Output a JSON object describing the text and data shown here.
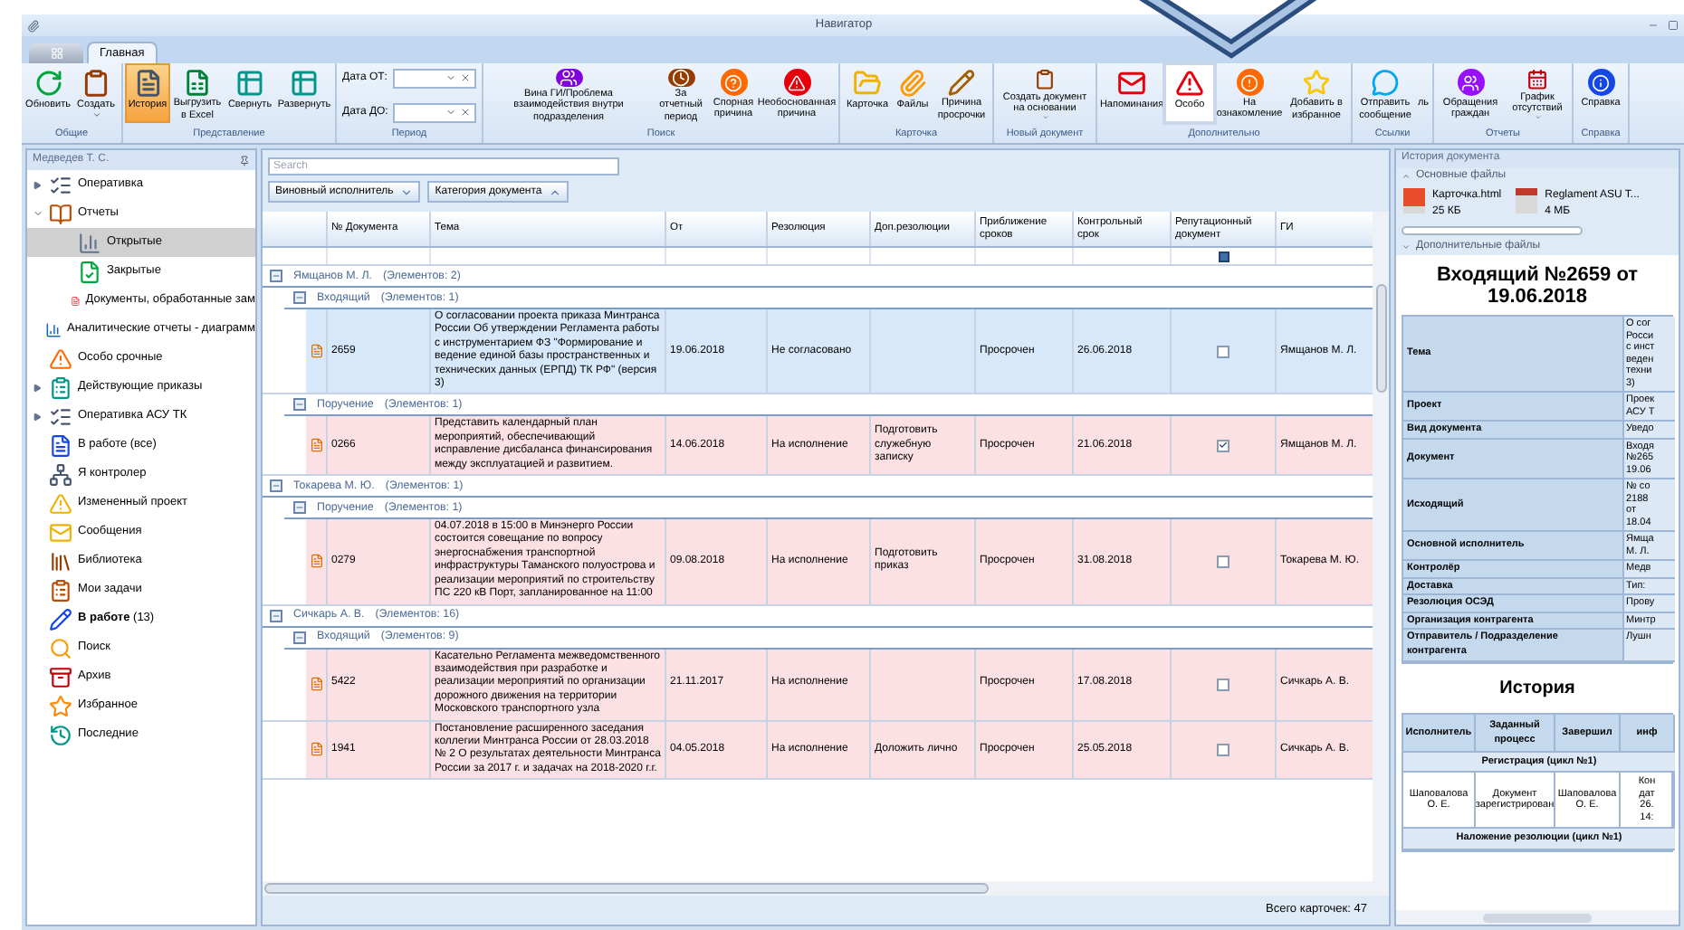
{
  "window": {
    "title": "Навигатор"
  },
  "ribbon_tabs": [
    {
      "label": "Главная",
      "selected": true
    }
  ],
  "ribbon_groups": [
    {
      "label": "Общие",
      "items": [
        {
          "kind": "button",
          "label": "Обновить",
          "selected": false,
          "hovered": false,
          "dropdown": false
        },
        {
          "kind": "button",
          "label": "Создать",
          "selected": false,
          "hovered": false,
          "dropdown": true
        }
      ]
    },
    {
      "label": "Представление",
      "items": [
        {
          "kind": "button",
          "label": "История",
          "selected": true,
          "hovered": false,
          "dropdown": false
        },
        {
          "kind": "button",
          "label": "Выгрузить в Excel",
          "selected": false,
          "hovered": false,
          "dropdown": false
        },
        {
          "kind": "button",
          "label": "Свернуть",
          "selected": false,
          "hovered": false,
          "dropdown": false
        },
        {
          "kind": "button",
          "label": "Развернуть",
          "selected": false,
          "hovered": false,
          "dropdown": false
        }
      ]
    },
    {
      "label": "Период",
      "items": [
        {
          "kind": "field",
          "label": "Дата ОТ:"
        },
        {
          "kind": "field",
          "label": "Дата ДО:"
        }
      ]
    },
    {
      "label": "Поиск",
      "items": [
        {
          "kind": "button",
          "label": "Вина ГИ/Проблема взаимодействия внутри подразделения",
          "selected": false,
          "hovered": false,
          "dropdown": false
        },
        {
          "kind": "button",
          "label": "За отчетный период",
          "selected": false,
          "hovered": false,
          "dropdown": false
        },
        {
          "kind": "button",
          "label": "Спорная причина",
          "selected": false,
          "hovered": false,
          "dropdown": false
        },
        {
          "kind": "button",
          "label": "Необоснованная причина",
          "selected": false,
          "hovered": false,
          "dropdown": false
        }
      ]
    },
    {
      "label": "Карточка",
      "items": [
        {
          "kind": "button",
          "label": "Карточка",
          "selected": false,
          "hovered": false,
          "dropdown": false
        },
        {
          "kind": "button",
          "label": "Файлы",
          "selected": false,
          "hovered": false,
          "dropdown": false
        },
        {
          "kind": "button",
          "label": "Причина просрочки",
          "selected": false,
          "hovered": false,
          "dropdown": false
        }
      ]
    },
    {
      "label": "Новый документ",
      "items": [
        {
          "kind": "button",
          "label": "Создать документ на основании",
          "selected": false,
          "hovered": false,
          "dropdown": true
        }
      ]
    },
    {
      "label": "Дополнительно",
      "items": [
        {
          "kind": "button",
          "label": "Напоминания",
          "selected": false,
          "hovered": false,
          "dropdown": false
        },
        {
          "kind": "button",
          "label": "Особо",
          "selected": false,
          "hovered": true,
          "dropdown": false
        },
        {
          "kind": "button",
          "label": "На ознакомление",
          "selected": false,
          "hovered": false,
          "dropdown": false
        },
        {
          "kind": "button",
          "label": "Добавить в избранное",
          "selected": false,
          "hovered": false,
          "dropdown": false
        }
      ]
    },
    {
      "label": "Ссылки",
      "items": [
        {
          "kind": "button",
          "label": "Отправить сообщение",
          "selected": false,
          "hovered": false,
          "dropdown": false
        },
        {
          "kind": "button",
          "label": "ль",
          "selected": false,
          "hovered": false,
          "dropdown": false
        }
      ]
    },
    {
      "label": "Отчеты",
      "items": [
        {
          "kind": "button",
          "label": "Обращения граждан",
          "selected": false,
          "hovered": false,
          "dropdown": false
        },
        {
          "kind": "button",
          "label": "График отсутствий",
          "selected": false,
          "hovered": false,
          "dropdown": true
        }
      ]
    },
    {
      "label": "Справка",
      "items": [
        {
          "kind": "button",
          "label": "Справка",
          "selected": false,
          "hovered": false,
          "dropdown": false
        }
      ]
    }
  ],
  "sidebar": {
    "title": "Медведев Т. С.",
    "items": [
      {
        "label": "Оперативка",
        "expanded": false,
        "selected": false
      },
      {
        "label": "Отчеты",
        "expanded": true,
        "selected": false,
        "children": [
          {
            "label": "Открытые",
            "selected": true
          },
          {
            "label": "Закрытые",
            "selected": false
          },
          {
            "label": "Документы, обработанные зам",
            "selected": false
          }
        ]
      },
      {
        "label": "Аналитические отчеты - диаграмм",
        "selected": false
      },
      {
        "label": "Особо срочные",
        "selected": false
      },
      {
        "label": "Действующие приказы",
        "expanded": false,
        "selected": false
      },
      {
        "label": "Оперативка АСУ ТК",
        "expanded": false,
        "selected": false
      },
      {
        "label": "В работе (все)",
        "selected": false
      },
      {
        "label": "Я контролер",
        "selected": false
      },
      {
        "label": "Измененный проект",
        "selected": false
      },
      {
        "label": "Сообщения",
        "selected": false
      },
      {
        "label": "Библиотека",
        "selected": false
      },
      {
        "label": "Мои задачи",
        "selected": false
      },
      {
        "label": "**В работе** (13)",
        "selected": false
      },
      {
        "label": "Поиск",
        "selected": false
      },
      {
        "label": "Архив",
        "selected": false
      },
      {
        "label": "Избранное",
        "selected": false
      },
      {
        "label": "Последние",
        "selected": false
      }
    ]
  },
  "search": {
    "placeholder": "Search"
  },
  "group_by": [
    {
      "label": "Виновный исполнитель",
      "ascending": false
    },
    {
      "label": "Категория документа",
      "ascending": true
    }
  ],
  "table": {
    "columns": [
      "№ Документа",
      "Тема",
      "От",
      "Резолюция",
      "Доп.резолюции",
      "Приближение сроков",
      "Контрольный срок",
      "Репутационный документ",
      "ГИ"
    ],
    "filter_checkbox": {
      "indeterminate": true
    },
    "groups": [
      {
        "name": "Ямщанов М. Л.",
        "count": "(Элементов: 2)",
        "expanded": true,
        "subgroups": [
          {
            "name": "Входящий",
            "count": "(Элементов: 1)",
            "expanded": true,
            "rows": [
              {
                "number": "2659",
                "subject": "О согласовании проекта приказа Минтранса России Об утверждении Регламента работы с инструментарием ФЗ \"Формирование и ведение единой базы пространственных и технических данных (ЕРПД) ТК РФ\" (версия 3)",
                "date": "19.06.2018",
                "resolution": "Не согласовано",
                "deadline_status": "Просрочен",
                "control_date": "26.06.2018",
                "reputational": false,
                "executor": "Ямщанов М. Л.",
                "selected": true
              }
            ]
          },
          {
            "name": "Поручение",
            "count": "(Элементов: 1)",
            "expanded": true,
            "rows": [
              {
                "number": "0266",
                "subject": "Представить календарный план мероприятий, обеспечивающий исправление дисбаланса финансирования между эксплуатацией и развитием.",
                "date": "14.06.2018",
                "resolution": "На исполнение",
                "extra_resolution": "Подготовить служебную записку",
                "deadline_status": "Просрочен",
                "control_date": "21.06.2018",
                "reputational": true,
                "executor": "Ямщанов М. Л.",
                "selected": false
              }
            ]
          }
        ]
      },
      {
        "name": "Токарева М. Ю.",
        "count": "(Элементов: 1)",
        "expanded": true,
        "subgroups": [
          {
            "name": "Поручение",
            "count": "(Элементов: 1)",
            "expanded": true,
            "rows": [
              {
                "number": "0279",
                "subject": "04.07.2018 в 15:00 в Минэнерго России состоится совещание по вопросу энергоснабжения транспортной инфраструктуры Таманского полуострова и реализации мероприятий по строительству ПС 220 кВ Порт, запланированное на 11:00",
                "date": "09.08.2018",
                "resolution": "На исполнение",
                "extra_resolution": "Подготовить приказ",
                "deadline_status": "Просрочен",
                "control_date": "31.08.2018",
                "reputational": false,
                "executor": "Токарева М. Ю.",
                "selected": false
              }
            ]
          }
        ]
      },
      {
        "name": "Сичкарь А. В.",
        "count": "(Элементов: 16)",
        "expanded": true,
        "subgroups": [
          {
            "name": "Входящий",
            "count": "(Элементов: 9)",
            "expanded": true,
            "rows": [
              {
                "number": "5422",
                "subject": "Касательно Регламента межведомственного взаимодействия при разработке и реализации мероприятий по организации дорожного движения на территории Московского транспортного узла",
                "date": "21.11.2017",
                "resolution": "На исполнение",
                "deadline_status": "Просрочен",
                "control_date": "17.08.2018",
                "reputational": false,
                "executor": "Сичкарь А. В.",
                "selected": false
              },
              {
                "number": "1941",
                "subject": "Постановление расширенного заседания коллегии Минтранса России от 28.03.2018 № 2 О результатах деятельности Минтранса России за 2017 г. и задачах на 2018-2020 г.г.",
                "date": "04.05.2018",
                "resolution": "На исполнение",
                "extra_resolution": "Доложить лично",
                "deadline_status": "Просрочен",
                "control_date": "25.05.2018",
                "reputational": false,
                "executor": "Сичкарь А. В.",
                "selected": false
              }
            ]
          }
        ]
      }
    ]
  },
  "footer": {
    "total": "Всего карточек: 47"
  },
  "history_panel": {
    "title": "История документа",
    "sections": [
      {
        "label": "Основные файлы",
        "expanded": true,
        "files": [
          {
            "kind": "html",
            "name": "Карточка.html",
            "size": "25 КБ"
          },
          {
            "kind": "pdf",
            "name": "Reglament ASU T...",
            "size": "4 МБ"
          }
        ]
      },
      {
        "label": "Дополнительные файлы",
        "expanded": false
      }
    ],
    "document": {
      "heading": "Входящий №2659 от 19.06.2018",
      "properties": [
        {
          "label": "Тема",
          "value": "О сог\nРосси\nс инст\nведен\nтехни\n3)"
        },
        {
          "label": "Проект",
          "value": "Проек\nАСУ Т"
        },
        {
          "label": "Вид документа",
          "value": "Уведо"
        },
        {
          "label": "Документ",
          "value": "Входя\n№265\n19.06"
        },
        {
          "label": "Исходящий",
          "value": "№ со\n2188\nот\n18.04"
        },
        {
          "label": "Основной исполнитель",
          "value": "Ямща\nМ. Л."
        },
        {
          "label": "Контролёр",
          "value": "Медв"
        },
        {
          "label": "Доставка",
          "value": "Тип:"
        },
        {
          "label": "Резолюция ОСЭД",
          "value": "Прову"
        },
        {
          "label": "Организация контрагента",
          "value": "Минтр"
        },
        {
          "label": "Отправитель / Подразделение контрагента",
          "value": "Лушн"
        }
      ],
      "history_heading": "История",
      "history_columns": [
        "Исполнитель",
        "Заданный процесс",
        "Завершил",
        "инф"
      ],
      "history": [
        {
          "stage": "Регистрация (цикл №1)",
          "rows": [
            [
              "Шаповалова О. Е.",
              "Документ зарегистрирован",
              "Шаповалова О. Е.",
              "Кон\nдат\n26.\n14:"
            ]
          ]
        },
        {
          "stage": "Наложение резолюции (цикл №1)"
        }
      ]
    }
  }
}
